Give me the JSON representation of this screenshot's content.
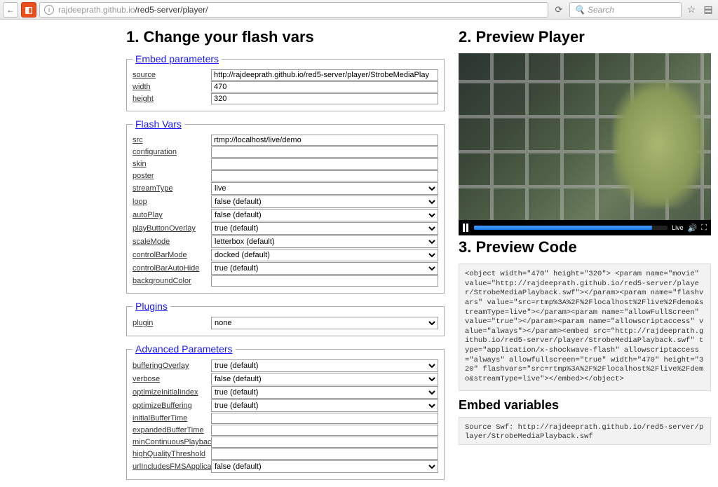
{
  "browser": {
    "url_gray": "rajdeeprath.github.io",
    "url_rest": "/red5-server/player/",
    "search_placeholder": "Search"
  },
  "headings": {
    "h1": "1. Change your flash vars",
    "h2": "2. Preview Player",
    "h3": "3. Preview Code",
    "embedvars": "Embed variables"
  },
  "legends": {
    "embed": "Embed parameters",
    "flashvars": "Flash Vars",
    "plugins": "Plugins",
    "advanced": "Advanced Parameters"
  },
  "embed": {
    "source_label": "source",
    "source_val": "http://rajdeeprath.github.io/red5-server/player/StrobeMediaPlay",
    "width_label": "width",
    "width_val": "470",
    "height_label": "height",
    "height_val": "320"
  },
  "flashvars": {
    "src_label": "src",
    "src_val": "rtmp://localhost/live/demo",
    "configuration_label": "configuration",
    "configuration_val": "",
    "skin_label": "skin",
    "skin_val": "",
    "poster_label": "poster",
    "poster_val": "",
    "streamType_label": "streamType",
    "streamType_val": "live",
    "loop_label": "loop",
    "loop_val": "false (default)",
    "autoPlay_label": "autoPlay",
    "autoPlay_val": "false (default)",
    "playButtonOverlay_label": "playButtonOverlay",
    "playButtonOverlay_val": "true (default)",
    "scaleMode_label": "scaleMode",
    "scaleMode_val": "letterbox (default)",
    "controlBarMode_label": "controlBarMode",
    "controlBarMode_val": "docked (default)",
    "controlBarAutoHide_label": "controlBarAutoHide",
    "controlBarAutoHide_val": "true (default)",
    "backgroundColor_label": "backgroundColor",
    "backgroundColor_val": ""
  },
  "plugins": {
    "plugin_label": "plugin",
    "plugin_val": "none"
  },
  "advanced": {
    "bufferingOverlay_label": "bufferingOverlay",
    "bufferingOverlay_val": "true (default)",
    "verbose_label": "verbose",
    "verbose_val": "false (default)",
    "optimizeInitialIndex_label": "optimizeInitialIndex",
    "optimizeInitialIndex_val": "true (default)",
    "optimizeBuffering_label": "optimizeBuffering",
    "optimizeBuffering_val": "true (default)",
    "initialBufferTime_label": "initialBufferTime",
    "initialBufferTime_val": "",
    "expandedBufferTime_label": "expandedBufferTime",
    "expandedBufferTime_val": "",
    "minContinuousPlaybackT_label": "minContinuousPlaybackT",
    "minContinuousPlaybackT_val": "",
    "highQualityThreshold_label": "highQualityThreshold",
    "highQualityThreshold_val": "",
    "urlIncludesFMSApplicatio_label": "urlIncludesFMSApplicatio",
    "urlIncludesFMSApplicatio_val": "false (default)"
  },
  "player": {
    "live_label": "Live"
  },
  "code": "<object width=\"470\" height=\"320\"> <param name=\"movie\" value=\"http://rajdeeprath.github.io/red5-server/player/StrobeMediaPlayback.swf\"></param><param name=\"flashvars\" value=\"src=rtmp%3A%2F%2Flocalhost%2Flive%2Fdemo&streamType=live\"></param><param name=\"allowFullScreen\" value=\"true\"></param><param name=\"allowscriptaccess\" value=\"always\"></param><embed src=\"http://rajdeeprath.github.io/red5-server/player/StrobeMediaPlayback.swf\" type=\"application/x-shockwave-flash\" allowscriptaccess=\"always\" allowfullscreen=\"true\" width=\"470\" height=\"320\" flashvars=\"src=rtmp%3A%2F%2Flocalhost%2Flive%2Fdemo&streamType=live\"></embed></object>",
  "embedvars_code": "Source Swf: http://rajdeeprath.github.io/red5-server/player/StrobeMediaPlayback.swf"
}
